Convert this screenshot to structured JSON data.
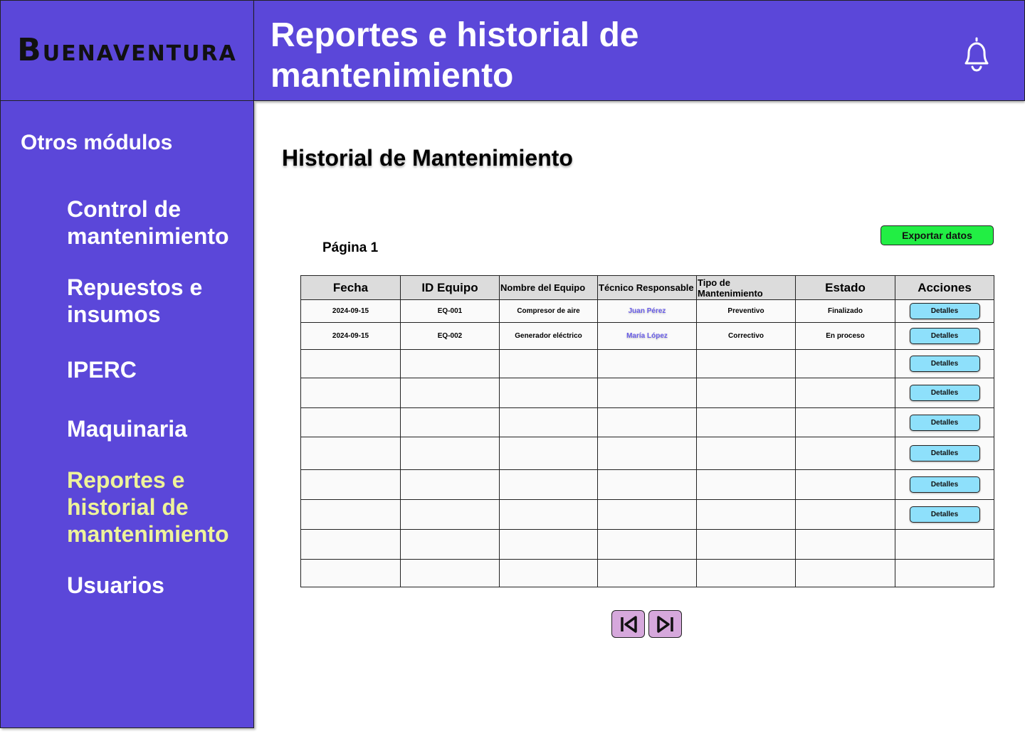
{
  "brand": {
    "logo_initial": "B",
    "logo_rest": "UENAVENTURA"
  },
  "header": {
    "title": "Reportes e historial de mantenimiento"
  },
  "sidebar": {
    "heading": "Otros módulos",
    "items": [
      {
        "label": "Control de mantenimiento",
        "active": false
      },
      {
        "label": "Repuestos e insumos",
        "active": false
      },
      {
        "label": "IPERC",
        "active": false
      },
      {
        "label": "Maquinaria",
        "active": false
      },
      {
        "label": "Reportes e historial de mantenimiento",
        "active": true
      },
      {
        "label": "Usuarios",
        "active": false
      }
    ]
  },
  "main": {
    "title": "Historial de Mantenimiento",
    "page_label": "Página 1",
    "export_label": "Exportar datos",
    "table": {
      "headers": [
        "Fecha",
        "ID Equipo",
        "Nombre del Equipo",
        "Técnico Responsable",
        "Tipo de Mantenimiento",
        "Estado",
        "Acciones"
      ],
      "rows": [
        [
          "2024-09-15",
          "EQ-001",
          "Compresor de aire",
          "Juan Pérez",
          "Preventivo",
          "Finalizado"
        ],
        [
          "2024-09-15",
          "EQ-002",
          "Generador eléctrico",
          "María López",
          "Correctivo",
          "En proceso"
        ]
      ],
      "details_label": "Detalles"
    }
  },
  "colors": {
    "primary": "#5b47d9",
    "active_nav": "#eef39a",
    "export_button": "#22ee44",
    "details_button": "#8ee0fb",
    "pager_button": "#d6a8dc",
    "technician_text": "#6a5ee8"
  },
  "icons": {
    "notification": "bell-icon",
    "pager_first": "skip-first-icon",
    "pager_last": "skip-last-icon"
  }
}
